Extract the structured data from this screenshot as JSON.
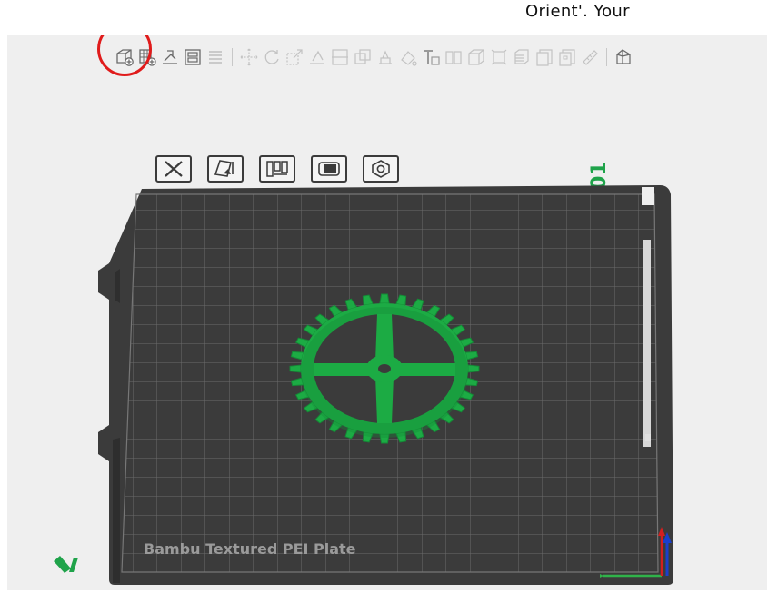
{
  "caption": "Orient'.  Your",
  "toolbar": {
    "buttons": [
      {
        "name": "add-object-icon"
      },
      {
        "name": "add-plate-icon"
      },
      {
        "name": "auto-orient-icon"
      },
      {
        "name": "arrange-icon"
      },
      {
        "name": "layers-icon"
      },
      {
        "name": "move-icon"
      },
      {
        "name": "rotate-icon"
      },
      {
        "name": "scale-icon"
      },
      {
        "name": "lay-on-face-icon"
      },
      {
        "name": "cut-icon"
      },
      {
        "name": "mesh-boolean-icon"
      },
      {
        "name": "support-paint-icon"
      },
      {
        "name": "seam-paint-icon"
      },
      {
        "name": "text-tool-icon"
      },
      {
        "name": "split-objects-icon"
      },
      {
        "name": "split-parts-icon"
      },
      {
        "name": "assemble-icon"
      },
      {
        "name": "variable-layer-height-icon"
      },
      {
        "name": "fuzzy-skin-icon"
      },
      {
        "name": "measure-icon"
      },
      {
        "name": "assembly-view-icon"
      }
    ]
  },
  "plate": {
    "number": "01",
    "name": "Bambu Textured PEI Plate",
    "plate_buttons": [
      {
        "name": "remove-plate-button"
      },
      {
        "name": "auto-orient-plate-button"
      },
      {
        "name": "arrange-plate-button"
      },
      {
        "name": "lock-plate-button"
      },
      {
        "name": "plate-settings-button"
      }
    ]
  },
  "colors": {
    "bed": "#3f3f3f",
    "grid": "#6b6b6b",
    "model": "#1cab44",
    "accent_green": "#1fa34a",
    "highlight": "#e01b1b",
    "axis_x": "#2fb34a",
    "axis_y": "#1a3fcc",
    "axis_z": "#d21f1f"
  }
}
